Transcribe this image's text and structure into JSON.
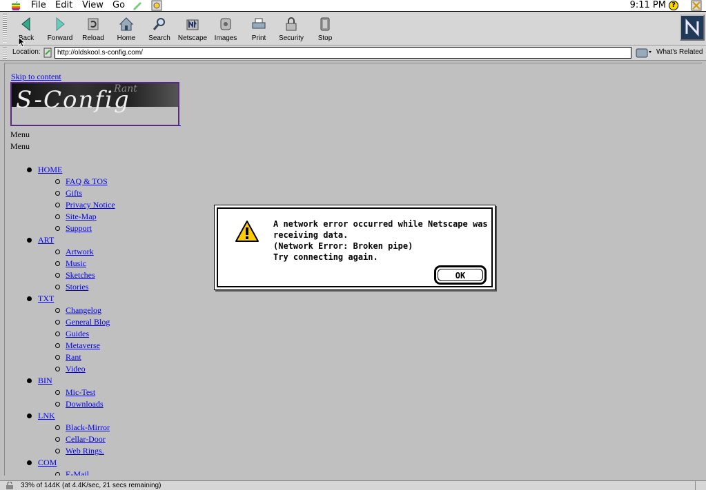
{
  "menubar": {
    "items": [
      "File",
      "Edit",
      "View",
      "Go"
    ],
    "clock": "9:11 PM",
    "help_icon": "help-icon",
    "app_icon": "netscape-app-icon"
  },
  "toolbar": {
    "buttons": [
      {
        "label": "Back",
        "icon": "back-arrow-icon"
      },
      {
        "label": "Forward",
        "icon": "forward-arrow-icon"
      },
      {
        "label": "Reload",
        "icon": "reload-icon"
      },
      {
        "label": "Home",
        "icon": "home-icon"
      },
      {
        "label": "Search",
        "icon": "search-icon"
      },
      {
        "label": "Netscape",
        "icon": "netscape-icon"
      },
      {
        "label": "Images",
        "icon": "images-icon"
      },
      {
        "label": "Print",
        "icon": "print-icon"
      },
      {
        "label": "Security",
        "icon": "security-lock-icon"
      },
      {
        "label": "Stop",
        "icon": "stop-icon"
      }
    ]
  },
  "location": {
    "label": "Location:",
    "url": "http://oldskool.s-config.com/",
    "whats_related": "What's Related"
  },
  "page": {
    "skip_link": "Skip to content",
    "banner_text": "S-Config",
    "banner_rant": "Rant",
    "menu_label_1": "Menu",
    "menu_label_2": "Menu",
    "nav": [
      {
        "label": "HOME",
        "children": [
          "FAQ & TOS",
          "Gifts",
          "Privacy Notice",
          "Site-Map",
          "Support"
        ]
      },
      {
        "label": "ART",
        "children": [
          "Artwork",
          "Music",
          "Sketches",
          "Stories"
        ]
      },
      {
        "label": "TXT",
        "children": [
          "Changelog",
          "General Blog",
          "Guides",
          "Metaverse",
          "Rant",
          "Video"
        ]
      },
      {
        "label": "BIN",
        "children": [
          "Mic-Test",
          "Downloads"
        ]
      },
      {
        "label": "LNK",
        "children": [
          "Black-Mirror",
          "Cellar-Door",
          "Web Rings."
        ]
      },
      {
        "label": "COM",
        "children": [
          "E-Mail"
        ]
      }
    ]
  },
  "status": {
    "text": "33% of 144K (at 4.4K/sec, 21 secs remaining)"
  },
  "dialog": {
    "lines": [
      "A network error occurred while Netscape was",
      "receiving data.",
      "(Network Error: Broken pipe)",
      "Try connecting again."
    ],
    "ok_label": "OK",
    "icon": "warning-icon"
  },
  "colors": {
    "link": "#0000ee",
    "background": "#c0c0c0",
    "banner_border": "#5a2a82"
  }
}
